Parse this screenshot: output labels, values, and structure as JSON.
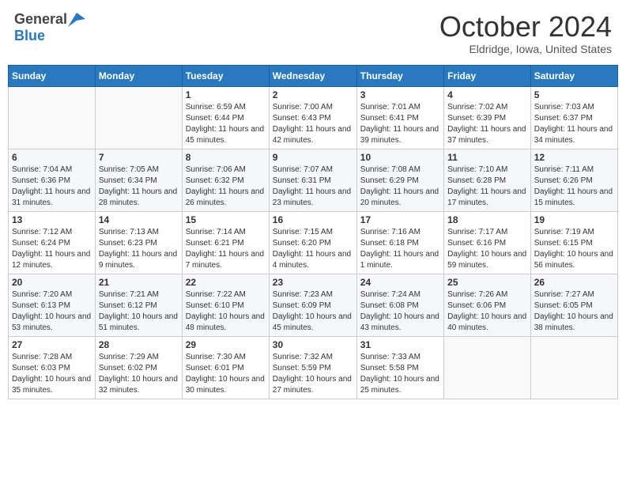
{
  "header": {
    "logo_general": "General",
    "logo_blue": "Blue",
    "month_title": "October 2024",
    "location": "Eldridge, Iowa, United States"
  },
  "calendar": {
    "days_of_week": [
      "Sunday",
      "Monday",
      "Tuesday",
      "Wednesday",
      "Thursday",
      "Friday",
      "Saturday"
    ],
    "weeks": [
      [
        {
          "day": "",
          "info": ""
        },
        {
          "day": "",
          "info": ""
        },
        {
          "day": "1",
          "info": "Sunrise: 6:59 AM\nSunset: 6:44 PM\nDaylight: 11 hours and 45 minutes."
        },
        {
          "day": "2",
          "info": "Sunrise: 7:00 AM\nSunset: 6:43 PM\nDaylight: 11 hours and 42 minutes."
        },
        {
          "day": "3",
          "info": "Sunrise: 7:01 AM\nSunset: 6:41 PM\nDaylight: 11 hours and 39 minutes."
        },
        {
          "day": "4",
          "info": "Sunrise: 7:02 AM\nSunset: 6:39 PM\nDaylight: 11 hours and 37 minutes."
        },
        {
          "day": "5",
          "info": "Sunrise: 7:03 AM\nSunset: 6:37 PM\nDaylight: 11 hours and 34 minutes."
        }
      ],
      [
        {
          "day": "6",
          "info": "Sunrise: 7:04 AM\nSunset: 6:36 PM\nDaylight: 11 hours and 31 minutes."
        },
        {
          "day": "7",
          "info": "Sunrise: 7:05 AM\nSunset: 6:34 PM\nDaylight: 11 hours and 28 minutes."
        },
        {
          "day": "8",
          "info": "Sunrise: 7:06 AM\nSunset: 6:32 PM\nDaylight: 11 hours and 26 minutes."
        },
        {
          "day": "9",
          "info": "Sunrise: 7:07 AM\nSunset: 6:31 PM\nDaylight: 11 hours and 23 minutes."
        },
        {
          "day": "10",
          "info": "Sunrise: 7:08 AM\nSunset: 6:29 PM\nDaylight: 11 hours and 20 minutes."
        },
        {
          "day": "11",
          "info": "Sunrise: 7:10 AM\nSunset: 6:28 PM\nDaylight: 11 hours and 17 minutes."
        },
        {
          "day": "12",
          "info": "Sunrise: 7:11 AM\nSunset: 6:26 PM\nDaylight: 11 hours and 15 minutes."
        }
      ],
      [
        {
          "day": "13",
          "info": "Sunrise: 7:12 AM\nSunset: 6:24 PM\nDaylight: 11 hours and 12 minutes."
        },
        {
          "day": "14",
          "info": "Sunrise: 7:13 AM\nSunset: 6:23 PM\nDaylight: 11 hours and 9 minutes."
        },
        {
          "day": "15",
          "info": "Sunrise: 7:14 AM\nSunset: 6:21 PM\nDaylight: 11 hours and 7 minutes."
        },
        {
          "day": "16",
          "info": "Sunrise: 7:15 AM\nSunset: 6:20 PM\nDaylight: 11 hours and 4 minutes."
        },
        {
          "day": "17",
          "info": "Sunrise: 7:16 AM\nSunset: 6:18 PM\nDaylight: 11 hours and 1 minute."
        },
        {
          "day": "18",
          "info": "Sunrise: 7:17 AM\nSunset: 6:16 PM\nDaylight: 10 hours and 59 minutes."
        },
        {
          "day": "19",
          "info": "Sunrise: 7:19 AM\nSunset: 6:15 PM\nDaylight: 10 hours and 56 minutes."
        }
      ],
      [
        {
          "day": "20",
          "info": "Sunrise: 7:20 AM\nSunset: 6:13 PM\nDaylight: 10 hours and 53 minutes."
        },
        {
          "day": "21",
          "info": "Sunrise: 7:21 AM\nSunset: 6:12 PM\nDaylight: 10 hours and 51 minutes."
        },
        {
          "day": "22",
          "info": "Sunrise: 7:22 AM\nSunset: 6:10 PM\nDaylight: 10 hours and 48 minutes."
        },
        {
          "day": "23",
          "info": "Sunrise: 7:23 AM\nSunset: 6:09 PM\nDaylight: 10 hours and 45 minutes."
        },
        {
          "day": "24",
          "info": "Sunrise: 7:24 AM\nSunset: 6:08 PM\nDaylight: 10 hours and 43 minutes."
        },
        {
          "day": "25",
          "info": "Sunrise: 7:26 AM\nSunset: 6:06 PM\nDaylight: 10 hours and 40 minutes."
        },
        {
          "day": "26",
          "info": "Sunrise: 7:27 AM\nSunset: 6:05 PM\nDaylight: 10 hours and 38 minutes."
        }
      ],
      [
        {
          "day": "27",
          "info": "Sunrise: 7:28 AM\nSunset: 6:03 PM\nDaylight: 10 hours and 35 minutes."
        },
        {
          "day": "28",
          "info": "Sunrise: 7:29 AM\nSunset: 6:02 PM\nDaylight: 10 hours and 32 minutes."
        },
        {
          "day": "29",
          "info": "Sunrise: 7:30 AM\nSunset: 6:01 PM\nDaylight: 10 hours and 30 minutes."
        },
        {
          "day": "30",
          "info": "Sunrise: 7:32 AM\nSunset: 5:59 PM\nDaylight: 10 hours and 27 minutes."
        },
        {
          "day": "31",
          "info": "Sunrise: 7:33 AM\nSunset: 5:58 PM\nDaylight: 10 hours and 25 minutes."
        },
        {
          "day": "",
          "info": ""
        },
        {
          "day": "",
          "info": ""
        }
      ]
    ]
  }
}
